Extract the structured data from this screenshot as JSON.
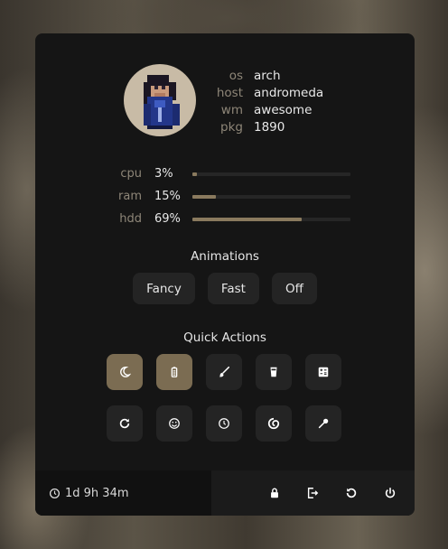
{
  "system": {
    "items": [
      {
        "key": "os",
        "value": "arch"
      },
      {
        "key": "host",
        "value": "andromeda"
      },
      {
        "key": "wm",
        "value": "awesome"
      },
      {
        "key": "pkg",
        "value": "1890"
      }
    ]
  },
  "stats": [
    {
      "label": "cpu",
      "percent_text": "3%",
      "fraction": 0.03
    },
    {
      "label": "ram",
      "percent_text": "15%",
      "fraction": 0.15
    },
    {
      "label": "hdd",
      "percent_text": "69%",
      "fraction": 0.69
    }
  ],
  "animations": {
    "title": "Animations",
    "options": [
      "Fancy",
      "Fast",
      "Off"
    ]
  },
  "quick_actions": {
    "title": "Quick Actions",
    "buttons": [
      {
        "icon": "moon-icon",
        "active": true
      },
      {
        "icon": "battery-icon",
        "active": true
      },
      {
        "icon": "brush-icon",
        "active": false
      },
      {
        "icon": "glass-icon",
        "active": false
      },
      {
        "icon": "calculator-icon",
        "active": false
      },
      {
        "icon": "refresh-icon",
        "active": false
      },
      {
        "icon": "smiley-icon",
        "active": false
      },
      {
        "icon": "clock-icon",
        "active": false
      },
      {
        "icon": "swirl-icon",
        "active": false
      },
      {
        "icon": "eyedropper-icon",
        "active": false
      }
    ]
  },
  "footer": {
    "uptime": "1d 9h 34m",
    "uptime_icon": "clock-icon",
    "actions": [
      "moon-icon",
      "lock-icon",
      "logout-icon",
      "restart-icon",
      "power-icon"
    ]
  },
  "colors": {
    "panel": "#151515",
    "button": "#242424",
    "accent": "#7b6c52",
    "muted_label": "#8e8678"
  }
}
